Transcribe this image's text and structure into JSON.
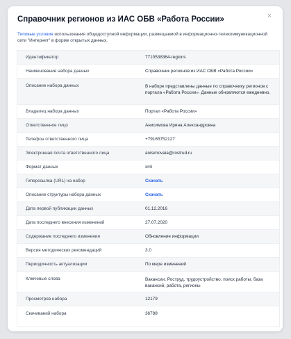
{
  "modal": {
    "title": "Справочник регионов из ИАС ОБВ «Работа России»",
    "close": "×",
    "terms_link": "Типовые условия",
    "terms_text": " использования общедоступной информации, размещаемой в информационно-телекоммуникационной сети \"Интернет\" в форме открытых данных."
  },
  "rows": [
    {
      "key": "Идентификатор",
      "value": "7710538364-regions"
    },
    {
      "key": "Наименование набора данных",
      "value": "Справочник регионов из ИАС ОБВ «Работа России»"
    },
    {
      "key": "Описание набора данных",
      "value": "В наборе представлены данные по справочнику регионов с портала «Работа России». Данные обновляются ежедневно."
    },
    {
      "key": "Владелец набора данных",
      "value": "Портал «Работа России»"
    },
    {
      "key": "Ответственное лицо",
      "value": "Анисимова Ирина Александровна"
    },
    {
      "key": "Телефон ответственного лица",
      "value": "+79165752127"
    },
    {
      "key": "Электронная почта ответственного лица",
      "value": "anisimovaia@rostrud.ru"
    },
    {
      "key": "Формат данных",
      "value": "xml"
    },
    {
      "key": "Гиперссылка (URL) на набор",
      "value": "Скачать"
    },
    {
      "key": "Описание структуры набора данных",
      "value": "Скачать"
    },
    {
      "key": "Дата первой публикации данных",
      "value": "01.12.2016"
    },
    {
      "key": "Дата последнего внесения изменений",
      "value": "27.07.2020"
    },
    {
      "key": "Содержание последнего изменения",
      "value": "Обновление информации"
    },
    {
      "key": "Версия методических рекомендаций",
      "value": "3.0"
    },
    {
      "key": "Периодичность актуализации",
      "value": "По мере изменений"
    },
    {
      "key": "Ключевые слова",
      "value": "Вакансии, Роструд, трудоустройство, поиск работы, база вакансий, работа, регионы"
    },
    {
      "key": "Просмотров набора",
      "value": "12179"
    },
    {
      "key": "Скачиваний набора",
      "value": "36788"
    }
  ]
}
